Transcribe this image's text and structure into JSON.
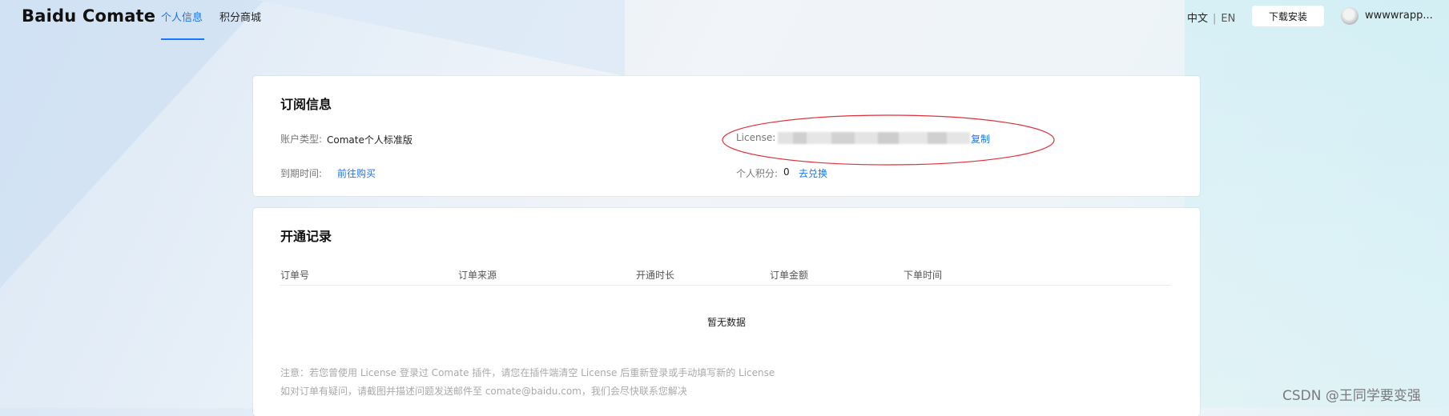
{
  "header": {
    "brand": "Baidu Comate",
    "tabs": [
      {
        "label": "个人信息",
        "active": true
      },
      {
        "label": "积分商城",
        "active": false
      }
    ],
    "lang_zh": "中文",
    "lang_sep": "|",
    "lang_en": "EN",
    "download_label": "下载安装",
    "username": "wwwwrapp..."
  },
  "subscription": {
    "title": "订阅信息",
    "account_type_label": "账户类型:",
    "account_type_value": "Comate个人标准版",
    "expire_label": "到期时间:",
    "buy_link": "前往购买",
    "license_label": "License:",
    "copy_link": "复制",
    "points_label": "个人积分:",
    "points_value": "0",
    "redeem_link": "去兑换"
  },
  "records": {
    "title": "开通记录",
    "columns": [
      "订单号",
      "订单来源",
      "开通时长",
      "订单金额",
      "下单时间"
    ],
    "empty_text": "暂无数据",
    "note1": "注意：若您曾使用 License 登录过 Comate 插件，请您在插件端清空 License 后重新登录或手动填写新的 License",
    "note2": "如对订单有疑问，请截图并描述问题发送邮件至 comate@baidu.com，我们会尽快联系您解决"
  },
  "watermark": "CSDN @王同学要变强",
  "colors": {
    "accent": "#1677ff",
    "annotation": "#e0303a"
  }
}
